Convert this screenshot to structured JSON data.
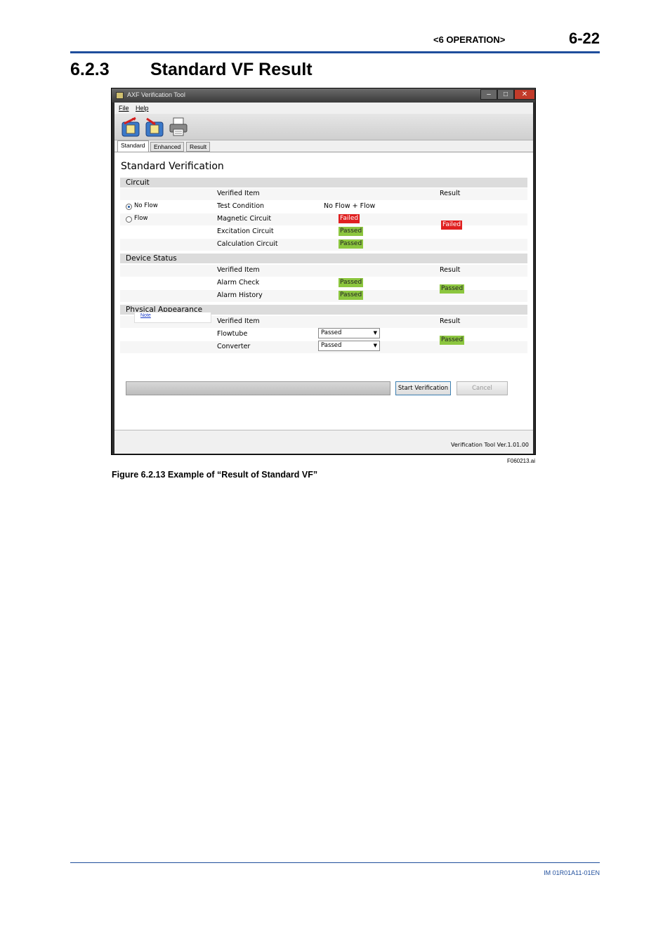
{
  "header": {
    "section": "<6  OPERATION>",
    "page_number": "6-22"
  },
  "section": {
    "number": "6.2.3",
    "title": "Standard VF Result"
  },
  "window": {
    "title": "AXF Verification Tool",
    "menu": [
      "File",
      "Help"
    ],
    "tabs": [
      "Standard",
      "Enhanced",
      "Result"
    ],
    "active_tab": "Standard",
    "panel_title": "Standard Verification",
    "circuit": {
      "label": "Circuit",
      "radio_options": [
        "No Flow",
        "Flow"
      ],
      "selected": "No Flow",
      "col_item": "Verified Item",
      "col_result": "Result",
      "rows": [
        {
          "item": "Test Condition",
          "value": "No Flow + Flow"
        },
        {
          "item": "Magnetic Circuit",
          "value": "Failed"
        },
        {
          "item": "Excitation Circuit",
          "value": "Passed"
        },
        {
          "item": "Calculation Circuit",
          "value": "Passed"
        }
      ],
      "result": "Failed"
    },
    "device_status": {
      "label": "Device Status",
      "col_item": "Verified Item",
      "col_result": "Result",
      "rows": [
        {
          "item": "Alarm Check",
          "value": "Passed"
        },
        {
          "item": "Alarm History",
          "value": "Passed"
        }
      ],
      "result": "Passed"
    },
    "physical_appearance": {
      "label": "Physical Appearance",
      "note_link": "Note",
      "col_item": "Verified Item",
      "col_result": "Result",
      "rows": [
        {
          "item": "Flowtube",
          "value": "Passed"
        },
        {
          "item": "Converter",
          "value": "Passed"
        }
      ],
      "result": "Passed"
    },
    "buttons": {
      "start": "Start Verification",
      "cancel": "Cancel"
    },
    "status_text": "Verification Tool Ver.1.01.00",
    "colors": {
      "failed": "#e02020",
      "passed": "#8cc63f"
    }
  },
  "figure": {
    "file_id": "F060213.ai",
    "caption": "Figure 6.2.13 Example of “Result of Standard VF”"
  },
  "footer": {
    "doc_id": "IM 01R01A11-01EN"
  }
}
